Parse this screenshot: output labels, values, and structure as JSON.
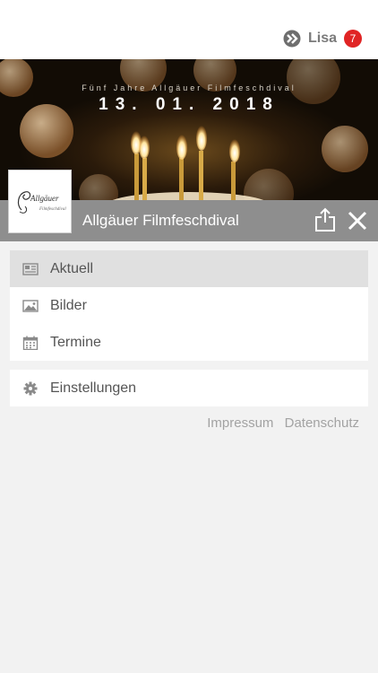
{
  "user": {
    "name": "Lisa",
    "notification_count": "7"
  },
  "hero": {
    "subtitle": "Fünf Jahre Allgäuer Filmfeschdival",
    "date": "13. 01. 2018"
  },
  "app": {
    "title": "Allgäuer Filmfeschdival",
    "logo_text": "Allgäuer Filmfeschdival"
  },
  "menu": {
    "items": [
      {
        "label": "Aktuell",
        "icon": "newspaper-icon",
        "active": true
      },
      {
        "label": "Bilder",
        "icon": "image-icon",
        "active": false
      },
      {
        "label": "Termine",
        "icon": "calendar-icon",
        "active": false
      }
    ],
    "settings": {
      "label": "Einstellungen",
      "icon": "gear-icon"
    }
  },
  "footer": {
    "impressum": "Impressum",
    "datenschutz": "Datenschutz"
  },
  "colors": {
    "badge": "#e02424",
    "titlebar": "#8e8e8e",
    "active_item": "#e0e0e0"
  }
}
